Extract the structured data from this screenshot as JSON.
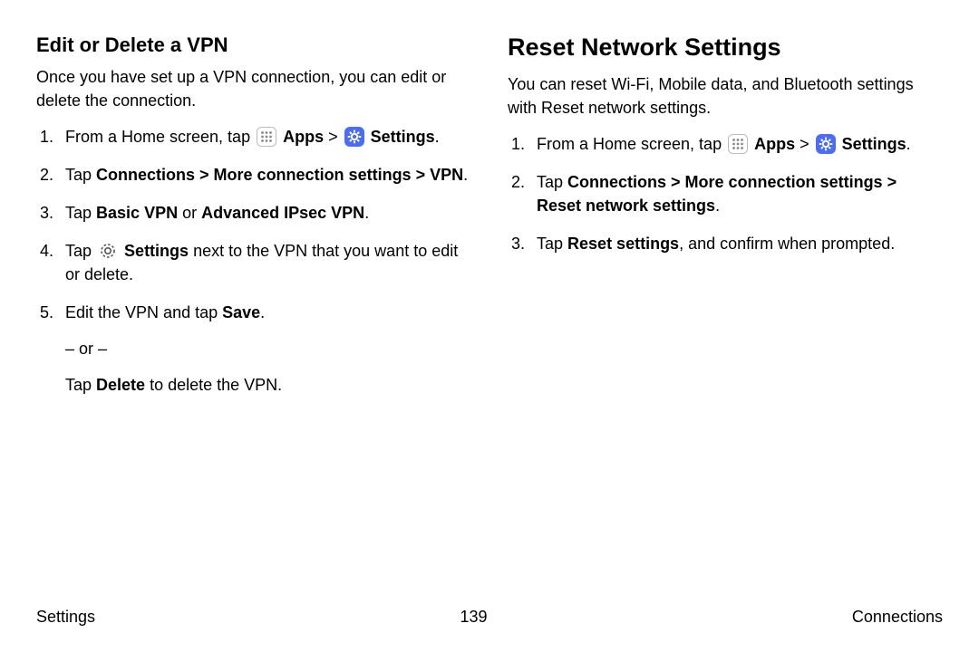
{
  "left": {
    "heading": "Edit or Delete a VPN",
    "intro": "Once you have set up a VPN connection, you can edit or delete the connection.",
    "step1_pre": "From a Home screen, tap ",
    "apps_label": "Apps",
    "sep": " > ",
    "settings_label": "Settings",
    "period": ".",
    "step2_pre": "Tap ",
    "step2_bold": "Connections > More connection settings > VPN",
    "step3_pre": "Tap ",
    "step3_b1": "Basic VPN",
    "step3_mid": " or ",
    "step3_b2": "Advanced IPsec VPN",
    "step4_pre": "Tap ",
    "step4_b": "Settings",
    "step4_post": " next to the VPN that you want to edit or delete.",
    "step5_pre": "Edit the VPN and tap ",
    "step5_b": "Save",
    "step5_or": "– or –",
    "step5_alt_pre": "Tap ",
    "step5_alt_b": "Delete",
    "step5_alt_post": " to delete the VPN."
  },
  "right": {
    "heading": "Reset Network Settings",
    "intro": "You can reset Wi-Fi, Mobile data, and Bluetooth settings with Reset network settings.",
    "step1_pre": "From a Home screen, tap ",
    "apps_label": "Apps",
    "sep": " > ",
    "settings_label": "Settings",
    "period": ".",
    "step2_pre": "Tap ",
    "step2_bold": "Connections > More connection settings > Reset network settings",
    "step3_pre": "Tap ",
    "step3_b": "Reset settings",
    "step3_post": ", and confirm when prompted."
  },
  "footer": {
    "left": "Settings",
    "center": "139",
    "right": "Connections"
  }
}
